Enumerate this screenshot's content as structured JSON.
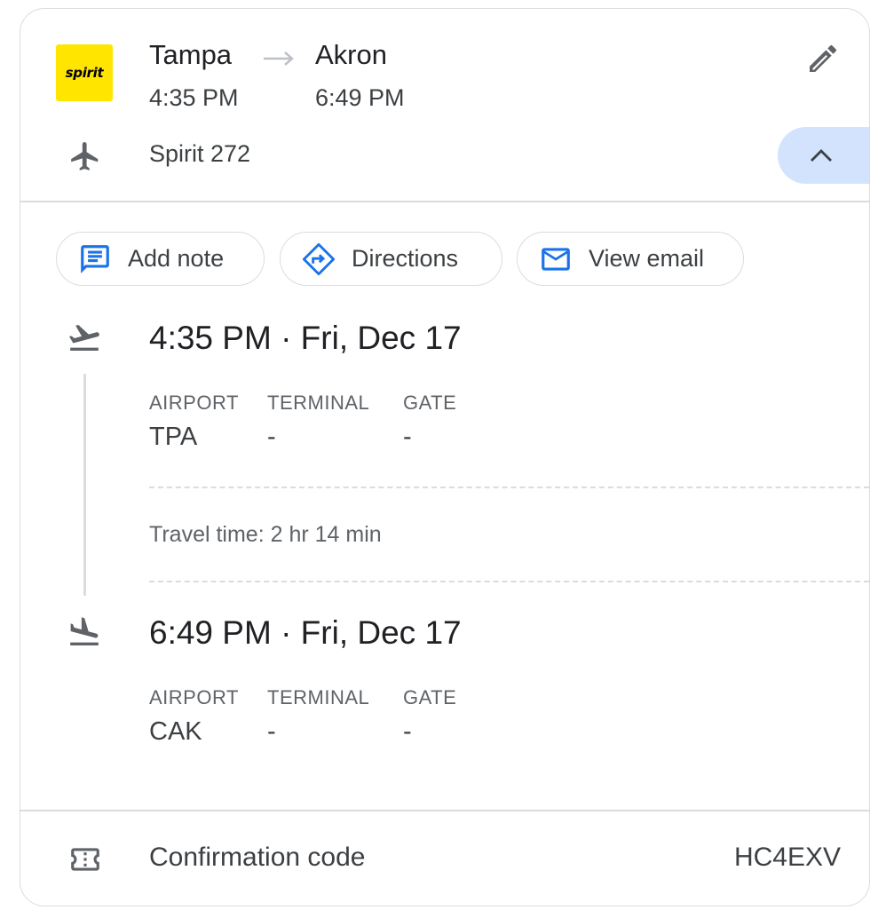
{
  "header": {
    "airline_logo_text": "spirit",
    "from_city": "Tampa",
    "to_city": "Akron",
    "depart_time": "4:35 PM",
    "arrive_time": "6:49 PM",
    "flight_number": "Spirit 272"
  },
  "actions": {
    "add_note": "Add note",
    "directions": "Directions",
    "view_email": "View email"
  },
  "departure": {
    "datetime": "4:35 PM · Fri, Dec 17",
    "labels": {
      "airport": "AIRPORT",
      "terminal": "TERMINAL",
      "gate": "GATE"
    },
    "airport": "TPA",
    "terminal": "-",
    "gate": "-"
  },
  "travel_time": "Travel time: 2 hr 14 min",
  "arrival": {
    "datetime": "6:49 PM · Fri, Dec 17",
    "labels": {
      "airport": "AIRPORT",
      "terminal": "TERMINAL",
      "gate": "GATE"
    },
    "airport": "CAK",
    "terminal": "-",
    "gate": "-"
  },
  "confirmation": {
    "label": "Confirmation code",
    "code": "HC4EXV"
  },
  "colors": {
    "logo_yellow": "#ffe500",
    "accent_blue": "#1a73e8",
    "collapse_bg": "#d3e3fd",
    "border": "#dadce0"
  },
  "icons": [
    "pencil-icon",
    "airplane-icon",
    "chevron-up-icon",
    "note-icon",
    "directions-icon",
    "mail-icon",
    "takeoff-icon",
    "landing-icon",
    "ticket-icon",
    "arrow-right-icon"
  ]
}
